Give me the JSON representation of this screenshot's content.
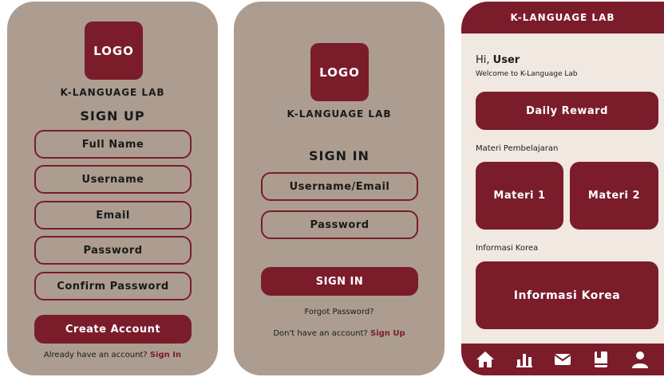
{
  "colors": {
    "accent": "#7b1c2b",
    "panel_bg": "#ac9d90",
    "home_bg": "#f0e8e1"
  },
  "signup": {
    "logo": "LOGO",
    "brand": "K-LANGUAGE LAB",
    "heading": "SIGN UP",
    "fields": [
      "Full Name",
      "Username",
      "Email",
      "Password",
      "Confirm Password"
    ],
    "submit": "Create Account",
    "footer_prefix": "Already have an account?",
    "footer_link": "Sign In"
  },
  "signin": {
    "logo": "LOGO",
    "brand": "K-LANGUAGE LAB",
    "heading": "SIGN IN",
    "fields": [
      "Username/Email",
      "Password"
    ],
    "submit": "SIGN IN",
    "forgot": "Forgot Password?",
    "footer_prefix": "Don't have an account?",
    "footer_link": "Sign Up"
  },
  "home": {
    "title": "K-LANGUAGE LAB",
    "greeting_prefix": "Hi,",
    "greeting_name": "User",
    "welcome": "Welcome to K-Language Lab",
    "daily_reward": "Daily Reward",
    "materials_label": "Materi Pembelajaran",
    "materials": [
      "Materi 1",
      "Materi 2"
    ],
    "info_label": "Informasi Korea",
    "info_card": "Informasi Korea",
    "nav": [
      "home-icon",
      "chart-icon",
      "mail-icon",
      "book-icon",
      "user-icon"
    ]
  }
}
